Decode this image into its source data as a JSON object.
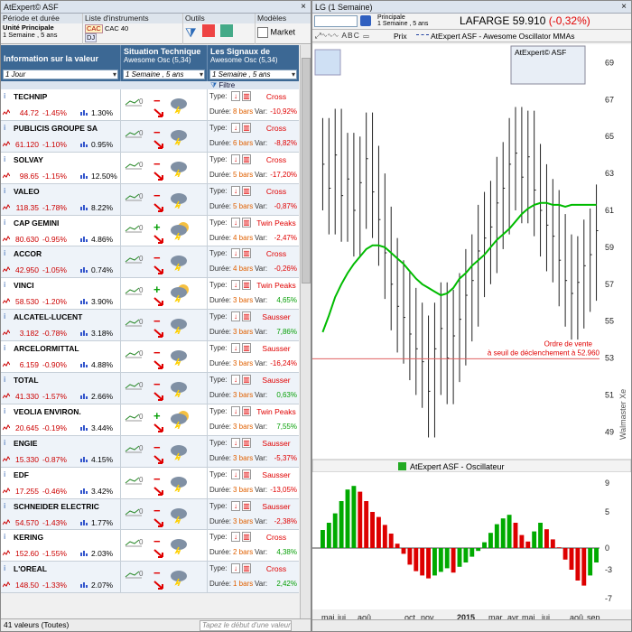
{
  "left_window": {
    "title": "AtExpert© ASF",
    "toolbar": {
      "periode_label": "Période et durée",
      "periode_unit": "Unité Principale",
      "periode_value": "1 Semaine , 5 ans",
      "liste_label": "Liste d'instruments",
      "liste_value": "CAC 40",
      "liste_tag1": "CAC",
      "liste_tag2": "DJ",
      "outils_label": "Outils",
      "modeles_label": "Modèles",
      "modeles_value": "Market"
    },
    "header": {
      "col1_title": "Information sur la valeur",
      "col1_dropdown": "1 Jour",
      "col2_title": "Situation Technique",
      "col2_sub": "Awesome Osc (5,34)",
      "col2_dropdown": "1 Semaine , 5 ans",
      "col3_title": "Les Signaux de",
      "col3_sub": "Awesome Osc (5,34)",
      "col3_dropdown": "1 Semaine , 5 ans",
      "filtre": "Filtre"
    },
    "labels": {
      "type": "Type:",
      "duree": "Durée:",
      "var": "Var:"
    },
    "rows": [
      {
        "name": "TECHNIP",
        "price": "44.72",
        "pct": "-1.45%",
        "vol": "1.30%",
        "signal": "minus",
        "pattern": "Cross",
        "bars": "8 bars",
        "var": "-10,92%"
      },
      {
        "name": "PUBLICIS GROUPE SA",
        "price": "61.120",
        "pct": "-1.10%",
        "vol": "0.95%",
        "signal": "minus",
        "pattern": "Cross",
        "bars": "6 bars",
        "var": "-8,82%"
      },
      {
        "name": "SOLVAY",
        "price": "98.65",
        "pct": "-1.15%",
        "vol": "12.50%",
        "signal": "minus",
        "pattern": "Cross",
        "bars": "5 bars",
        "var": "-17,20%"
      },
      {
        "name": "VALEO",
        "price": "118.35",
        "pct": "-1.78%",
        "vol": "8.22%",
        "signal": "minus",
        "pattern": "Cross",
        "bars": "5 bars",
        "var": "-0,87%"
      },
      {
        "name": "CAP GEMINI",
        "price": "80.630",
        "pct": "-0.95%",
        "vol": "4.86%",
        "signal": "plus",
        "pattern": "Twin Peaks",
        "bars": "4 bars",
        "var": "-2,47%"
      },
      {
        "name": "ACCOR",
        "price": "42.950",
        "pct": "-1.05%",
        "vol": "0.74%",
        "signal": "minus",
        "pattern": "Cross",
        "bars": "4 bars",
        "var": "-0,26%"
      },
      {
        "name": "VINCI",
        "price": "58.530",
        "pct": "-1.20%",
        "vol": "3.90%",
        "signal": "plus",
        "pattern": "Twin Peaks",
        "bars": "3 bars",
        "var": "4,65%"
      },
      {
        "name": "ALCATEL-LUCENT",
        "price": "3.182",
        "pct": "-0.78%",
        "vol": "3.18%",
        "signal": "minus",
        "pattern": "Sausser",
        "bars": "3 bars",
        "var": "7,86%"
      },
      {
        "name": "ARCELORMITTAL",
        "price": "6.159",
        "pct": "-0.90%",
        "vol": "4.88%",
        "signal": "minus",
        "pattern": "Sausser",
        "bars": "3 bars",
        "var": "-16,24%"
      },
      {
        "name": "TOTAL",
        "price": "41.330",
        "pct": "-1.57%",
        "vol": "2.66%",
        "signal": "minus",
        "pattern": "Sausser",
        "bars": "3 bars",
        "var": "0,63%"
      },
      {
        "name": "VEOLIA ENVIRON.",
        "price": "20.645",
        "pct": "-0.19%",
        "vol": "3.44%",
        "signal": "plus",
        "pattern": "Twin Peaks",
        "bars": "3 bars",
        "var": "7,55%"
      },
      {
        "name": "ENGIE",
        "price": "15.330",
        "pct": "-0.87%",
        "vol": "4.15%",
        "signal": "minus",
        "pattern": "Sausser",
        "bars": "3 bars",
        "var": "-5,37%"
      },
      {
        "name": "EDF",
        "price": "17.255",
        "pct": "-0.46%",
        "vol": "3.42%",
        "signal": "minus",
        "pattern": "Sausser",
        "bars": "3 bars",
        "var": "-13,05%"
      },
      {
        "name": "SCHNEIDER ELECTRIC",
        "price": "54.570",
        "pct": "-1.43%",
        "vol": "1.77%",
        "signal": "minus",
        "pattern": "Sausser",
        "bars": "3 bars",
        "var": "-2,38%"
      },
      {
        "name": "KERING",
        "price": "152.60",
        "pct": "-1.55%",
        "vol": "2.03%",
        "signal": "minus",
        "pattern": "Cross",
        "bars": "2 bars",
        "var": "4,38%"
      },
      {
        "name": "L'OREAL",
        "price": "148.50",
        "pct": "-1.33%",
        "vol": "2.07%",
        "signal": "minus",
        "pattern": "Cross",
        "bars": "1 bars",
        "var": "2,42%"
      }
    ],
    "status_count": "41 valeurs (Toutes)",
    "status_search_placeholder": "Tapez le début d'une valeur"
  },
  "right_window": {
    "title": "LG (1 Semaine)",
    "toolbar_unit": "Principale",
    "toolbar_period": "1 Semaine , 5 ans",
    "instrument": "LAFARGE",
    "price": "59.910",
    "change": "(-0,32%)",
    "legend_prix": "Prix",
    "legend_asf": "AtExpert ASF - Awesome Oscillator MMAs",
    "panel_title": "AtExpert© ASF",
    "order_line1": "Ordre de vente",
    "order_line2": "à seuil de déclenchement à 52.960",
    "osc_title": "AtExpert ASF - Oscillateur",
    "watermark": "Walmaster Xe",
    "colors": {
      "up": "#00aa00",
      "down": "#dd0000",
      "ma": "#00bb00",
      "ma_red": "#e00000"
    }
  },
  "chart_data": [
    {
      "type": "bar",
      "title": "LAFARGE",
      "y_ticks": [
        49,
        51,
        53,
        55,
        57,
        59,
        61,
        63,
        65,
        67,
        69
      ],
      "ylim": [
        47.5,
        70
      ],
      "x_ticks": [
        "mai",
        "jui",
        "aoû",
        "oct",
        "nov",
        "2015",
        "mar",
        "avr",
        "mai",
        "jui",
        "aoû",
        "sep"
      ],
      "threshold": 52.96,
      "ohlc_close": [
        63.5,
        62.2,
        64.0,
        61.8,
        62.7,
        61.0,
        62.5,
        63.8,
        62.0,
        60.5,
        58.7,
        57.0,
        55.8,
        55.2,
        54.3,
        53.5,
        52.8,
        51.2,
        53.5,
        54.6,
        53.0,
        54.2,
        55.1,
        56.4,
        57.2,
        58.8,
        59.5,
        60.1,
        61.4,
        62.2,
        63.5,
        64.1,
        62.8,
        63.9,
        62.1,
        61.0,
        60.2,
        59.6,
        58.3,
        57.2,
        56.5,
        57.1,
        58.0,
        58.6,
        59.9
      ],
      "ma_values": [
        54.4,
        55.3,
        56.3,
        57.0,
        57.6,
        58.1,
        58.5,
        58.9,
        59.1,
        59.1,
        59.0,
        58.7,
        58.4,
        58.1,
        57.7,
        57.3,
        57.0,
        56.8,
        56.6,
        56.4,
        56.5,
        56.8,
        57.3,
        57.6,
        58.0,
        58.3,
        58.6,
        59.0,
        59.4,
        59.7,
        60.0,
        60.4,
        60.8,
        61.1,
        61.3,
        61.4,
        61.4,
        61.3,
        61.3,
        61.2,
        61.3,
        61.3,
        61.3,
        61.3,
        61.3
      ]
    },
    {
      "type": "bar",
      "title": "AtExpert ASF - Oscillateur",
      "y_ticks": [
        -7,
        -3,
        0,
        5,
        9
      ],
      "ylim": [
        -8.5,
        10.5
      ],
      "values": [
        2.5,
        3.5,
        4.8,
        6.5,
        8.1,
        8.6,
        7.8,
        6.5,
        5.0,
        4.3,
        3.2,
        2.0,
        0.6,
        -0.8,
        -2.3,
        -3.2,
        -3.8,
        -4.2,
        -3.8,
        -3.3,
        -2.8,
        -3.4,
        -2.6,
        -2.0,
        -1.2,
        -0.4,
        0.8,
        2.1,
        3.3,
        4.1,
        4.6,
        3.5,
        1.8,
        0.9,
        2.3,
        3.5,
        2.6,
        1.2,
        0.1,
        -1.6,
        -3.0,
        -4.5,
        -5.2,
        -3.8,
        -2.0
      ]
    }
  ]
}
